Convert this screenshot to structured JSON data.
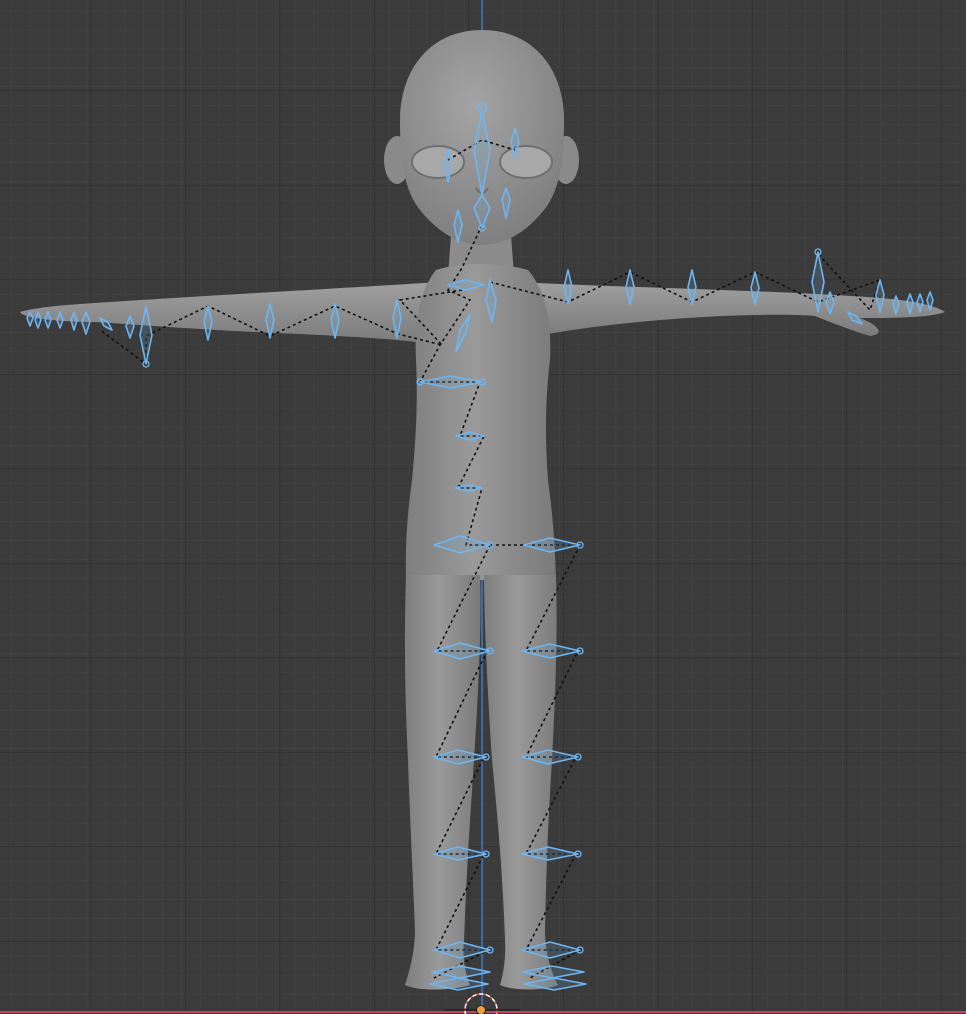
{
  "viewport": {
    "view": "front-orthographic",
    "grid_visible": true,
    "colors": {
      "background": "#3b3b3b",
      "grid_minor": "#444444",
      "grid_major": "#2f2f2f",
      "axis_z": "#3e78c8",
      "axis_x": "#c0445a",
      "mesh_fill": "#8e8e8e",
      "bone_selected": "#6fb5f0",
      "relationship_line": "#111111",
      "origin_point": "#f0a030",
      "cursor_ring": "#e06060"
    },
    "mesh": {
      "name": "character-body",
      "pose": "T-pose"
    },
    "armature": {
      "mode": "pose",
      "selection": "all-bones-selected"
    }
  }
}
